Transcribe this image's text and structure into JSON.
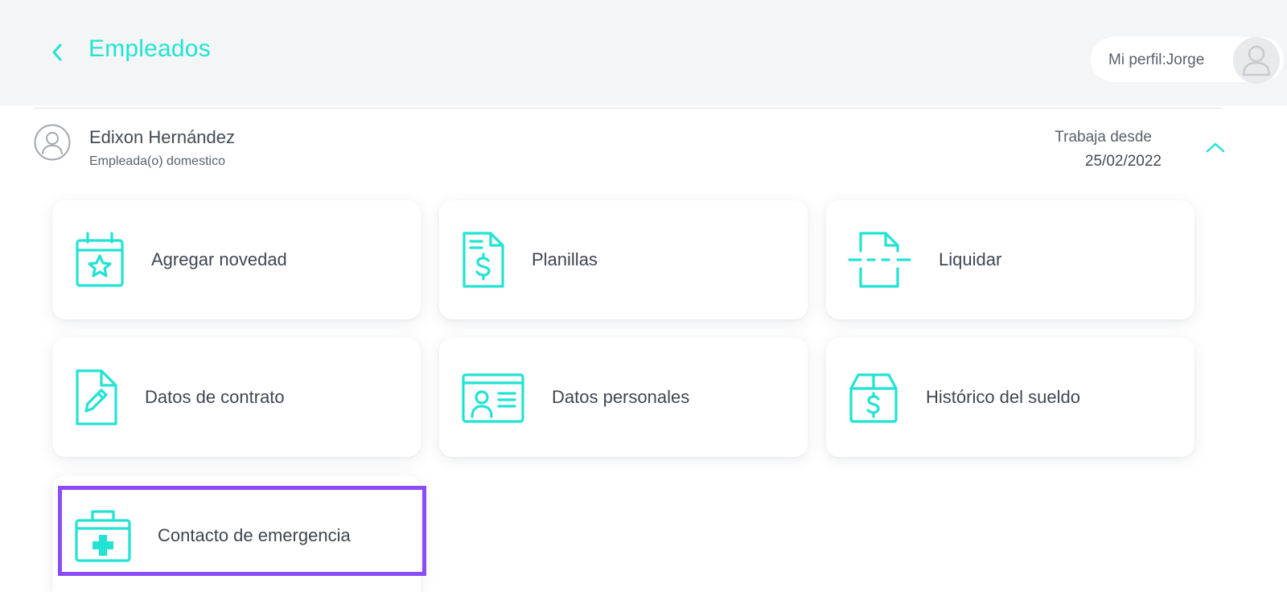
{
  "header": {
    "title": "Empleados",
    "profile_label": "Mi perfil:Jorge"
  },
  "employee": {
    "name": "Edixon Hernández",
    "role": "Empleada(o) domestico",
    "since_label": "Trabaja desde",
    "since_date": "25/02/2022"
  },
  "actions": [
    {
      "label": "Agregar novedad",
      "icon": "calendar-star-icon"
    },
    {
      "label": "Planillas",
      "icon": "document-dollar-icon"
    },
    {
      "label": "Liquidar",
      "icon": "document-cut-icon"
    },
    {
      "label": "Datos de contrato",
      "icon": "document-pencil-icon"
    },
    {
      "label": "Datos personales",
      "icon": "id-card-icon"
    },
    {
      "label": "Histórico del sueldo",
      "icon": "box-dollar-icon"
    },
    {
      "label": "Contacto de emergencia",
      "icon": "first-aid-kit-icon"
    }
  ],
  "colors": {
    "accent": "#22e3d3",
    "highlight": "#8b4cf7",
    "header_bg": "#f4f5f7"
  }
}
